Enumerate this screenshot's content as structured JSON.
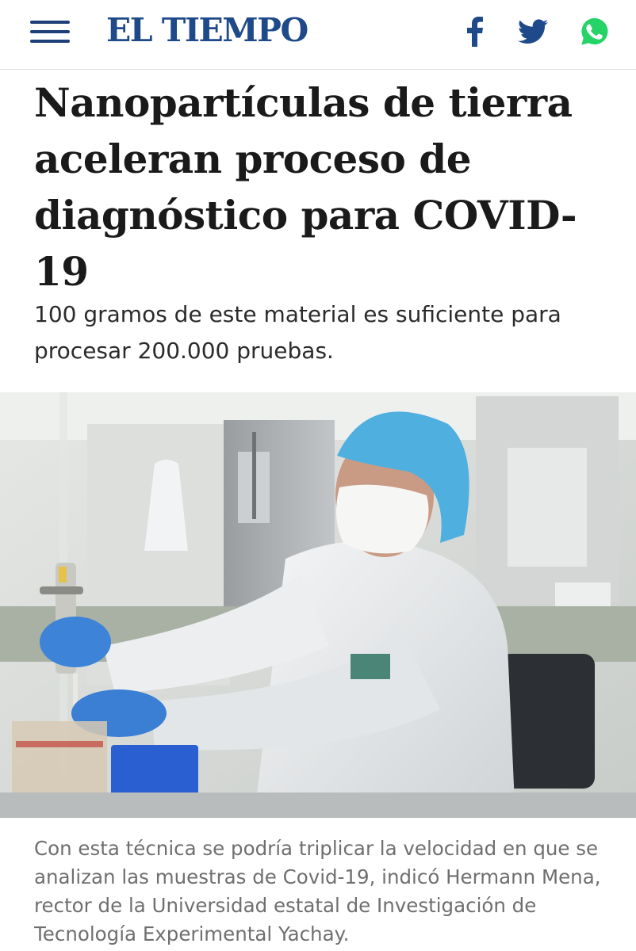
{
  "header": {
    "menu_icon": "hamburger-menu-icon",
    "logo_text": "EL TIEMPO",
    "share_icons": [
      "facebook-icon",
      "twitter-icon",
      "whatsapp-icon"
    ],
    "colors": {
      "brand": "#1f4a8a",
      "whatsapp": "#25d366"
    }
  },
  "article": {
    "title": "Nanopartículas de tierra aceleran proceso de diagnóstico para COVID-19",
    "subtitle": "100 gramos de este material es suficiente para procesar 200.000 pruebas.",
    "image": {
      "description_icon": "lab-technician-photo"
    },
    "caption": "Con esta técnica se podría triplicar la velocidad en que se analizan las muestras de Covid-19, indicó Hermann Mena, rector de la Universidad estatal de Investigación de Tecnología Experimental Yachay."
  }
}
